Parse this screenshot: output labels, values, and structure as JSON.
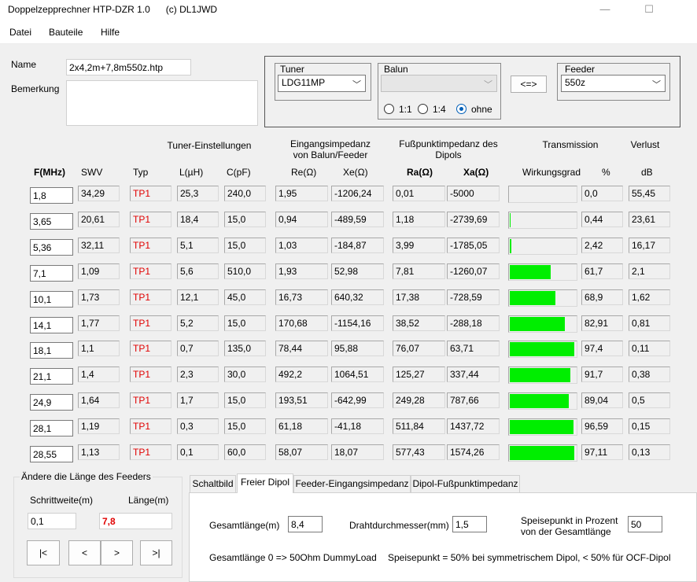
{
  "window": {
    "title": "Doppelzepprechner HTP-DZR 1.0",
    "copyright": "(c) DL1JWD",
    "min_glyph": "—",
    "max_glyph": "☐"
  },
  "menu": [
    "Datei",
    "Bauteile",
    "Hilfe"
  ],
  "file": {
    "name_label": "Name",
    "name_value": "2x4,2m+7,8m550z.htp",
    "remark_label": "Bemerkung",
    "remark_value": ""
  },
  "tuner": {
    "label": "Tuner",
    "value": "LDG11MP"
  },
  "balun": {
    "label": "Balun",
    "value": "",
    "options": [
      "1:1",
      "1:4",
      "ohne"
    ],
    "selected": "ohne"
  },
  "swap_button": "<=>",
  "feeder": {
    "label": "Feeder",
    "value": "550z"
  },
  "headers": {
    "tuner_settings": "Tuner-Einstellungen",
    "input_imp_1": "Eingangsimpedanz",
    "input_imp_2": "von Balun/Feeder",
    "feed_imp_1": "Fußpunktimpedanz des",
    "feed_imp_2": "Dipols",
    "transmission": "Transmission",
    "loss": "Verlust",
    "f": "F(MHz)",
    "swv": "SWV",
    "typ": "Typ",
    "l": "L(µH)",
    "c": "C(pF)",
    "re": "Re(Ω)",
    "xe": "Xe(Ω)",
    "ra": "Ra(Ω)",
    "xa": "Xa(Ω)",
    "eff": "Wirkungsgrad",
    "pct": "%",
    "db": "dB"
  },
  "rows": [
    {
      "f": "1,8",
      "swv": "34,29",
      "typ": "TP1",
      "l": "25,3",
      "c": "240,0",
      "re": "1,95",
      "xe": "-1206,24",
      "ra": "0,01",
      "xa": "-5000",
      "pct": "0,0",
      "db": "55,45",
      "eff": 0.0
    },
    {
      "f": "3,65",
      "swv": "20,61",
      "typ": "TP1",
      "l": "18,4",
      "c": "15,0",
      "re": "0,94",
      "xe": "-489,59",
      "ra": "1,18",
      "xa": "-2739,69",
      "pct": "0,44",
      "db": "23,61",
      "eff": 0.0044
    },
    {
      "f": "5,36",
      "swv": "32,11",
      "typ": "TP1",
      "l": "5,1",
      "c": "15,0",
      "re": "1,03",
      "xe": "-184,87",
      "ra": "3,99",
      "xa": "-1785,05",
      "pct": "2,42",
      "db": "16,17",
      "eff": 0.0242
    },
    {
      "f": "7,1",
      "swv": "1,09",
      "typ": "TP1",
      "l": "5,6",
      "c": "510,0",
      "re": "1,93",
      "xe": "52,98",
      "ra": "7,81",
      "xa": "-1260,07",
      "pct": "61,7",
      "db": "2,1",
      "eff": 0.617
    },
    {
      "f": "10,1",
      "swv": "1,73",
      "typ": "TP1",
      "l": "12,1",
      "c": "45,0",
      "re": "16,73",
      "xe": "640,32",
      "ra": "17,38",
      "xa": "-728,59",
      "pct": "68,9",
      "db": "1,62",
      "eff": 0.689
    },
    {
      "f": "14,1",
      "swv": "1,77",
      "typ": "TP1",
      "l": "5,2",
      "c": "15,0",
      "re": "170,68",
      "xe": "-1154,16",
      "ra": "38,52",
      "xa": "-288,18",
      "pct": "82,91",
      "db": "0,81",
      "eff": 0.8291
    },
    {
      "f": "18,1",
      "swv": "1,1",
      "typ": "TP1",
      "l": "0,7",
      "c": "135,0",
      "re": "78,44",
      "xe": "95,88",
      "ra": "76,07",
      "xa": "63,71",
      "pct": "97,4",
      "db": "0,11",
      "eff": 0.974
    },
    {
      "f": "21,1",
      "swv": "1,4",
      "typ": "TP1",
      "l": "2,3",
      "c": "30,0",
      "re": "492,2",
      "xe": "1064,51",
      "ra": "125,27",
      "xa": "337,44",
      "pct": "91,7",
      "db": "0,38",
      "eff": 0.917
    },
    {
      "f": "24,9",
      "swv": "1,64",
      "typ": "TP1",
      "l": "1,7",
      "c": "15,0",
      "re": "193,51",
      "xe": "-642,99",
      "ra": "249,28",
      "xa": "787,66",
      "pct": "89,04",
      "db": "0,5",
      "eff": 0.8904
    },
    {
      "f": "28,1",
      "swv": "1,19",
      "typ": "TP1",
      "l": "0,3",
      "c": "15,0",
      "re": "61,18",
      "xe": "-41,18",
      "ra": "511,84",
      "xa": "1437,72",
      "pct": "96,59",
      "db": "0,15",
      "eff": 0.9659
    },
    {
      "f": "28,55",
      "swv": "1,13",
      "typ": "TP1",
      "l": "0,1",
      "c": "60,0",
      "re": "58,07",
      "xe": "18,07",
      "ra": "577,43",
      "xa": "1574,26",
      "pct": "97,11",
      "db": "0,13",
      "eff": 0.9711
    }
  ],
  "feeder_length": {
    "group_label": "Ändere die Länge des Feeders",
    "step_label": "Schrittweite(m)",
    "step_value": "0,1",
    "length_label": "Länge(m)",
    "length_value": "7,8",
    "buttons": [
      "|<",
      "<",
      ">",
      ">|"
    ]
  },
  "tabs": {
    "items": [
      "Schaltbild",
      "Freier Dipol",
      "Feeder-Eingangsimpedanz",
      "Dipol-Fußpunktimpedanz"
    ],
    "active": "Freier Dipol"
  },
  "dipole": {
    "total_label": "Gesamtlänge(m)",
    "total_value": "8,4",
    "wire_label": "Drahtdurchmesser(mm)",
    "wire_value": "1,5",
    "feed_label_1": "Speisepunkt in Prozent",
    "feed_label_2": "von der Gesamtlänge",
    "feed_value": "50",
    "note1": "Gesamtlänge 0 => 50Ohm DummyLoad",
    "note2": "Speisepunkt = 50% bei symmetrischem Dipol,  < 50% für OCF-Dipol"
  },
  "colors": {
    "bar": "#00ee00",
    "tp": "#e00000",
    "length_value": "#e00000"
  }
}
